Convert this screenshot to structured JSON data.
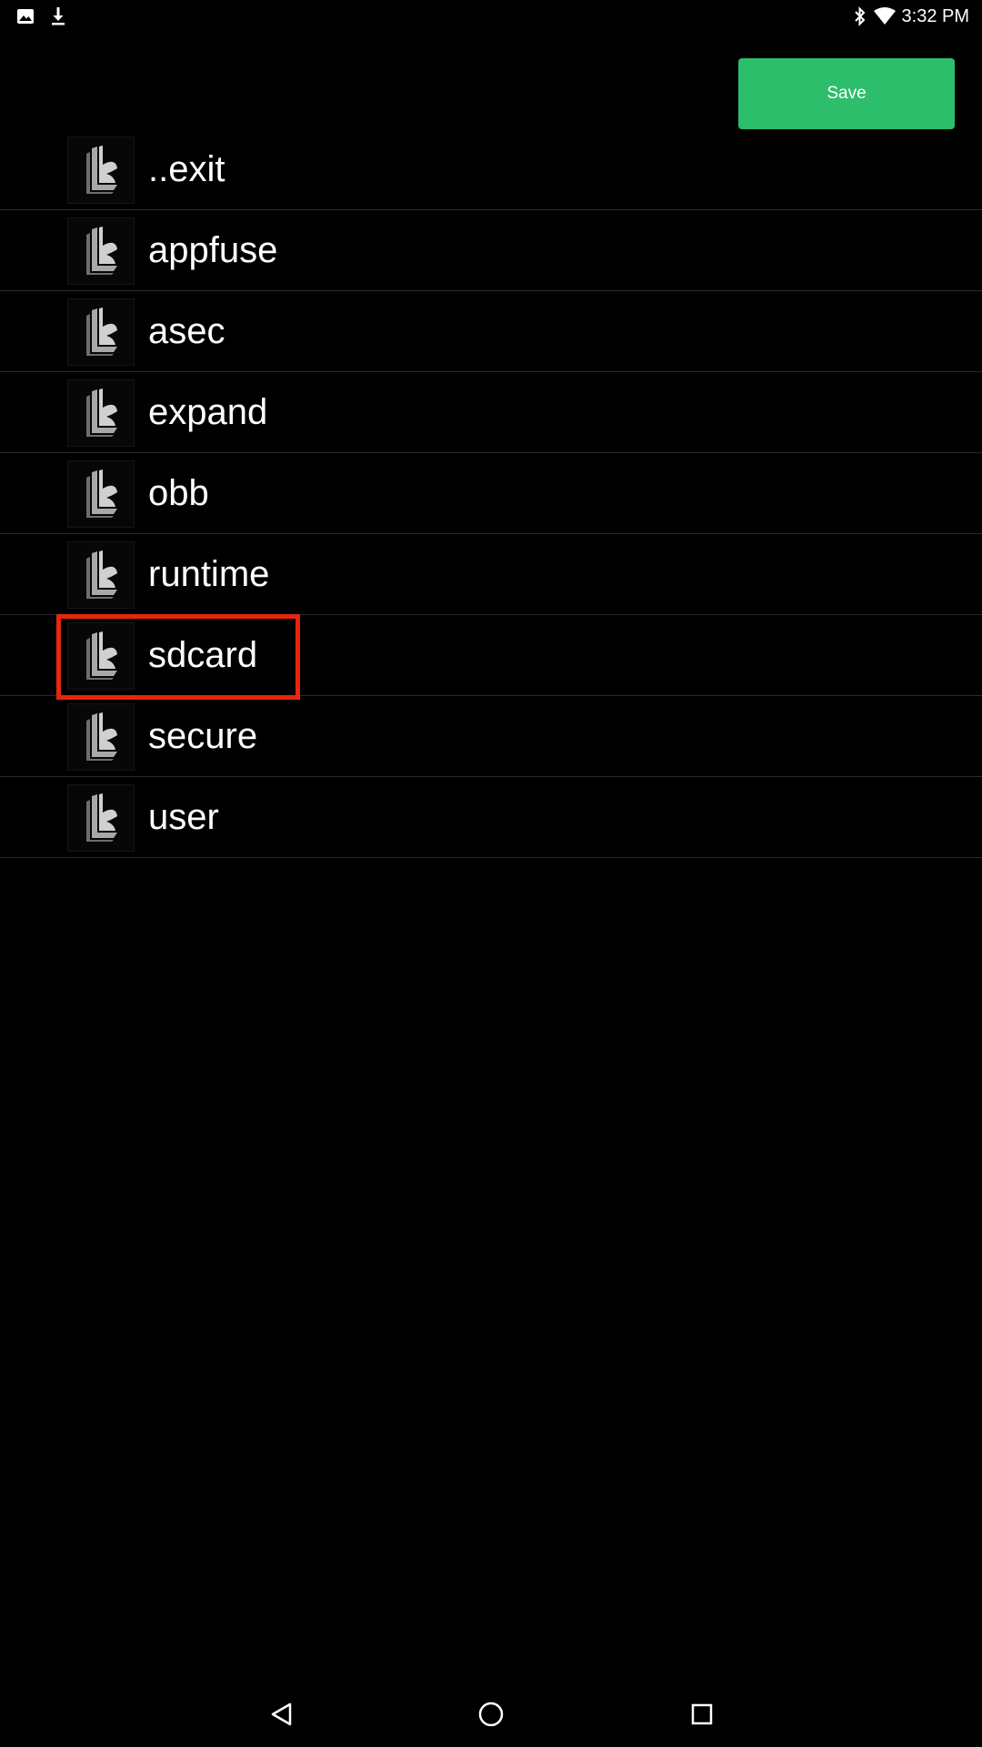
{
  "status_bar": {
    "time": "3:32 PM",
    "left_icons": [
      "image-icon",
      "download-icon"
    ],
    "right_icons": [
      "bluetooth-icon",
      "wifi-icon"
    ]
  },
  "toolbar": {
    "save_label": "Save"
  },
  "folders": [
    {
      "label": "..exit",
      "icon": "folder-app-icon"
    },
    {
      "label": "appfuse",
      "icon": "folder-app-icon"
    },
    {
      "label": "asec",
      "icon": "folder-app-icon"
    },
    {
      "label": "expand",
      "icon": "folder-app-icon"
    },
    {
      "label": "obb",
      "icon": "folder-app-icon"
    },
    {
      "label": "runtime",
      "icon": "folder-app-icon"
    },
    {
      "label": "sdcard",
      "icon": "folder-app-icon",
      "highlighted": true
    },
    {
      "label": "secure",
      "icon": "folder-app-icon"
    },
    {
      "label": "user",
      "icon": "folder-app-icon"
    }
  ],
  "nav_bar": {
    "buttons": [
      "back-icon",
      "home-icon",
      "recents-icon"
    ]
  },
  "colors": {
    "background": "#000000",
    "save_button": "#2dbe6c",
    "highlight": "#e8260e",
    "divider": "#2b2b2b"
  }
}
